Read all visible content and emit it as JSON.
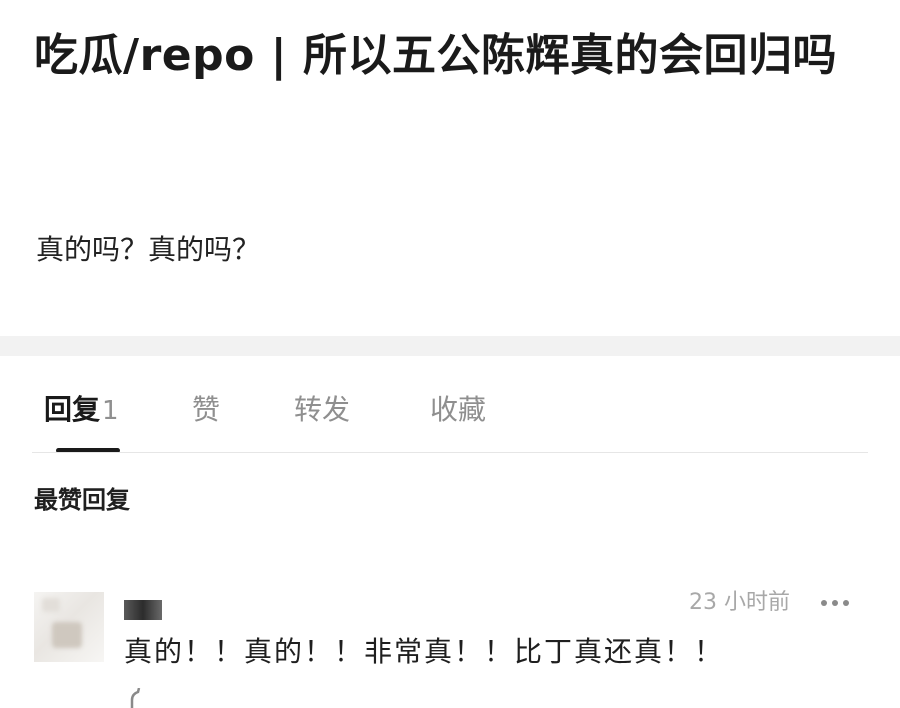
{
  "post": {
    "title": "吃瓜/repo | 所以五公陈辉真的会回归吗",
    "body": "真的吗？真的吗？"
  },
  "tabs": [
    {
      "label": "回复",
      "count": "1",
      "active": true
    },
    {
      "label": "赞",
      "count": "",
      "active": false
    },
    {
      "label": "转发",
      "count": "",
      "active": false
    },
    {
      "label": "收藏",
      "count": "",
      "active": false
    }
  ],
  "section": {
    "title": "最赞回复"
  },
  "reply": {
    "timestamp": "23 小时前",
    "text": "真的！！真的！！非常真！！比丁真还真！！",
    "more_icon": "more-dots-icon"
  },
  "colors": {
    "primary_text": "#1a1a1a",
    "muted_text": "#8f8f8f",
    "separator": "#f2f2f2",
    "divider": "#e6e6e6"
  }
}
